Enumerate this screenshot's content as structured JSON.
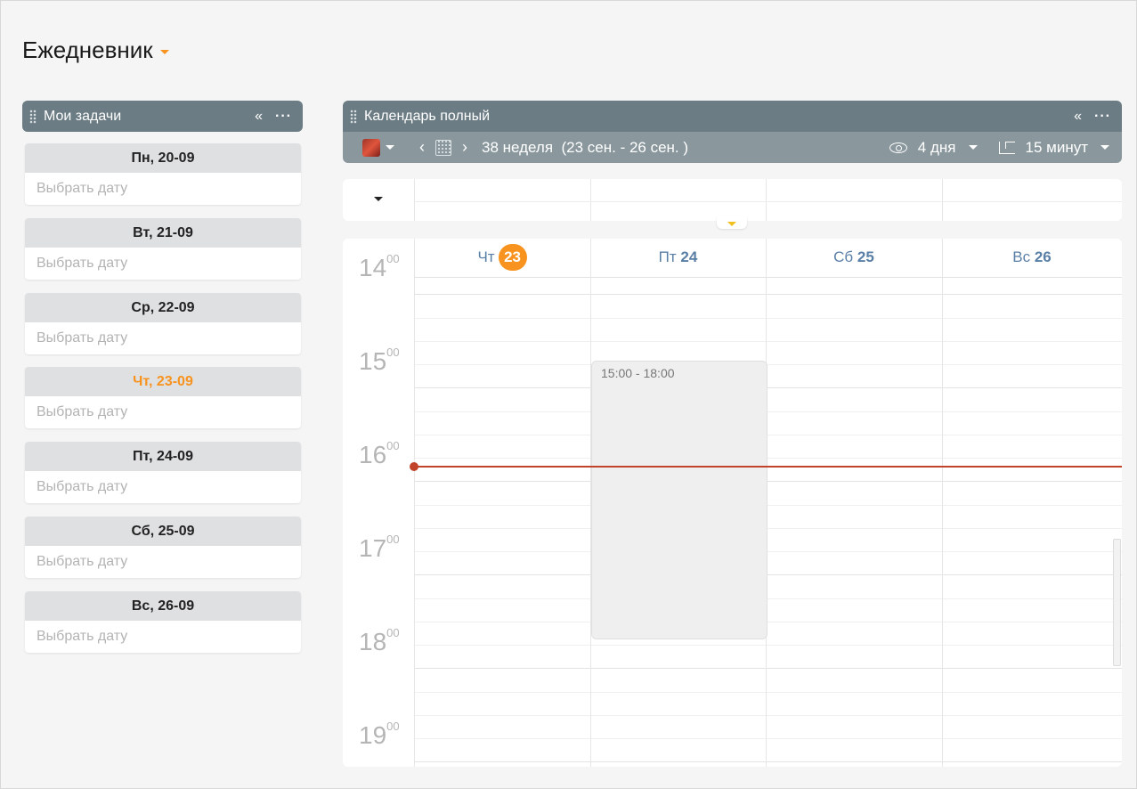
{
  "page": {
    "title": "Ежедневник"
  },
  "tasks": {
    "header": {
      "title": "Мои задачи",
      "collapse": "«",
      "menu": "···"
    },
    "days": [
      {
        "label": "Пн, 20-09",
        "placeholder": "Выбрать дату",
        "today": false
      },
      {
        "label": "Вт, 21-09",
        "placeholder": "Выбрать дату",
        "today": false
      },
      {
        "label": "Ср, 22-09",
        "placeholder": "Выбрать дату",
        "today": false
      },
      {
        "label": "Чт, 23-09",
        "placeholder": "Выбрать дату",
        "today": true
      },
      {
        "label": "Пт, 24-09",
        "placeholder": "Выбрать дату",
        "today": false
      },
      {
        "label": "Сб, 25-09",
        "placeholder": "Выбрать дату",
        "today": false
      },
      {
        "label": "Вс, 26-09",
        "placeholder": "Выбрать дату",
        "today": false
      }
    ]
  },
  "calendar": {
    "header": {
      "title": "Календарь полный",
      "collapse": "«",
      "menu": "···"
    },
    "toolbar": {
      "prev": "‹",
      "next": "›",
      "period": "38 неделя  (23 сен. - 26 сен. )",
      "view": "4 дня",
      "step": "15 минут"
    },
    "days": [
      {
        "weekday": "Чт",
        "date": "23",
        "today": true
      },
      {
        "weekday": "Пт",
        "date": "24",
        "today": false
      },
      {
        "weekday": "Сб",
        "date": "25",
        "today": false
      },
      {
        "weekday": "Вс",
        "date": "26",
        "today": false
      }
    ],
    "hours": [
      {
        "hour": "14",
        "minutes": "00"
      },
      {
        "hour": "15",
        "minutes": "00"
      },
      {
        "hour": "16",
        "minutes": "00"
      },
      {
        "hour": "17",
        "minutes": "00"
      },
      {
        "hour": "18",
        "minutes": "00"
      },
      {
        "hour": "19",
        "minutes": "00"
      }
    ],
    "events": [
      {
        "label": "15:00 - 18:00",
        "day": "24"
      }
    ],
    "colors": {
      "accent": "#f7931e",
      "now_line": "#c0432a",
      "header": "#6b7c84"
    }
  }
}
